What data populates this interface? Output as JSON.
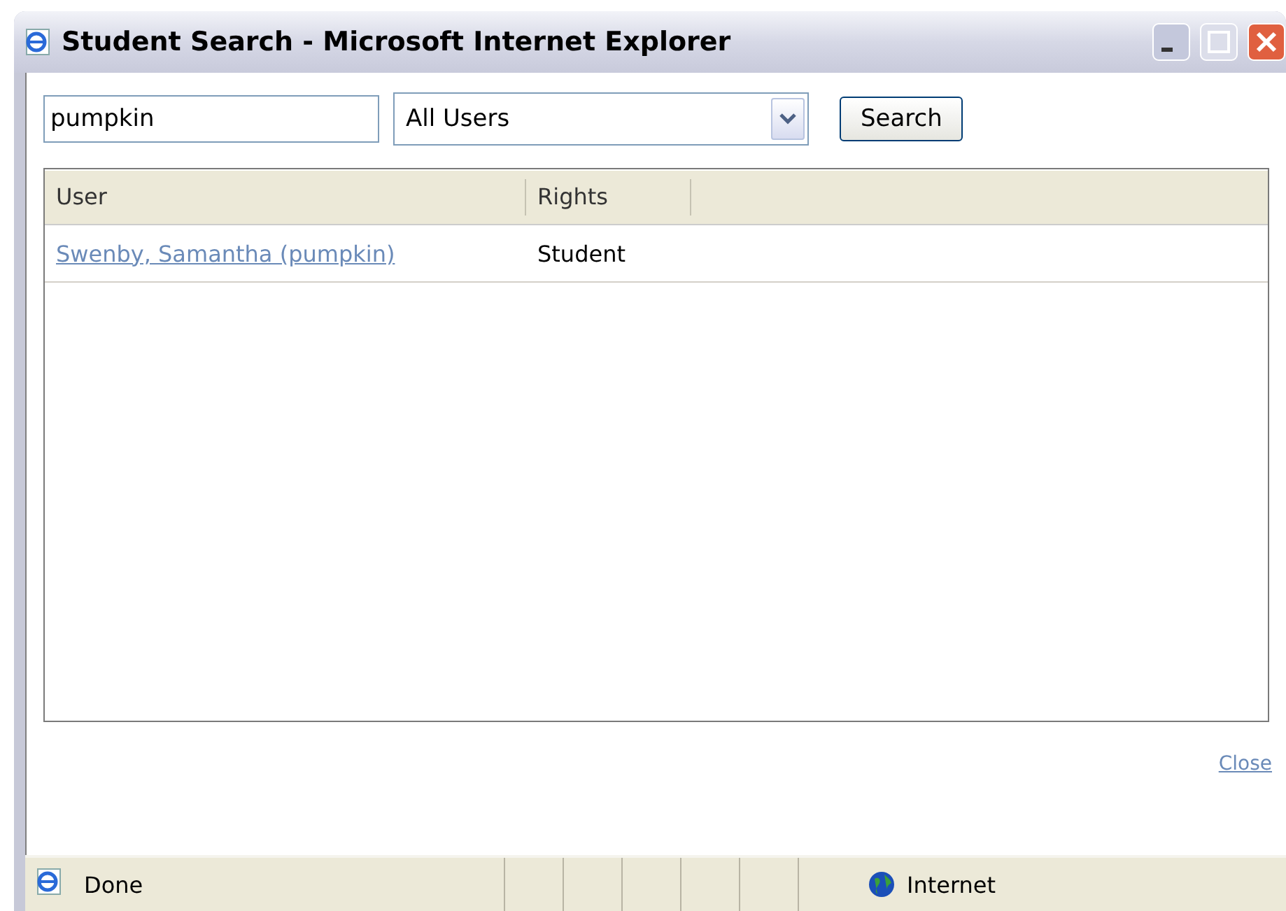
{
  "window": {
    "title": "Student Search - Microsoft Internet Explorer"
  },
  "search": {
    "value": "pumpkin",
    "filter": "All Users",
    "button": "Search"
  },
  "table": {
    "columns": [
      "User",
      "Rights"
    ],
    "rows": [
      {
        "user": "Swenby, Samantha (pumpkin)",
        "rights": "Student"
      }
    ]
  },
  "close_link": "Close",
  "status_bar": {
    "status": "Done",
    "zone": "Internet"
  }
}
